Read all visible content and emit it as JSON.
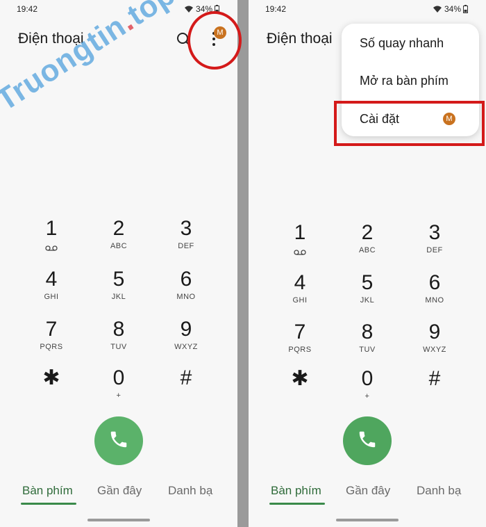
{
  "status": {
    "time": "19:42",
    "battery": "34%"
  },
  "dialer": {
    "title": "Điện thoại",
    "avatar_initial": "M",
    "keys": [
      {
        "digit": "1",
        "letters": "",
        "icon": "voicemail-icon"
      },
      {
        "digit": "2",
        "letters": "ABC"
      },
      {
        "digit": "3",
        "letters": "DEF"
      },
      {
        "digit": "4",
        "letters": "GHI"
      },
      {
        "digit": "5",
        "letters": "JKL"
      },
      {
        "digit": "6",
        "letters": "MNO"
      },
      {
        "digit": "7",
        "letters": "PQRS"
      },
      {
        "digit": "8",
        "letters": "TUV"
      },
      {
        "digit": "9",
        "letters": "WXYZ"
      },
      {
        "digit": "✱",
        "letters": ""
      },
      {
        "digit": "0",
        "letters": "+"
      },
      {
        "digit": "#",
        "letters": ""
      }
    ],
    "tabs": [
      {
        "label": "Bàn phím",
        "active": true
      },
      {
        "label": "Gần đây"
      },
      {
        "label": "Danh bạ"
      }
    ]
  },
  "menu": {
    "items": [
      {
        "label": "Số quay nhanh"
      },
      {
        "label": "Mở ra bàn phím"
      },
      {
        "label": "Cài đặt"
      }
    ]
  },
  "watermark": {
    "text_main": "Truongtin",
    "text_dot": ".",
    "text_tld": "top"
  },
  "colors": {
    "call_green": "#5bb26a",
    "active_tab": "#2f6b3a",
    "highlight_red": "#d41a1a",
    "avatar": "#c9721f"
  }
}
